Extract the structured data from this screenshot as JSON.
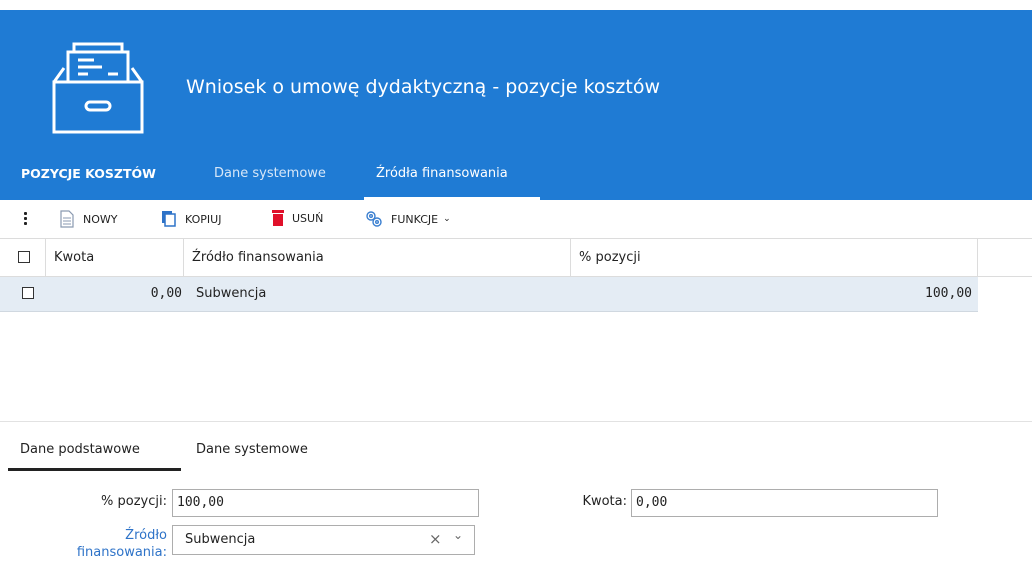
{
  "header": {
    "title": "Wniosek o umowę dydaktyczną - pozycje kosztów",
    "background_color": "#1f7bd4",
    "icon": "archive-drawer-icon"
  },
  "tabs": [
    {
      "label": "POZYCJE KOSZTÓW"
    },
    {
      "label": "Dane systemowe"
    },
    {
      "label": "Źródła finansowania",
      "active": true
    }
  ],
  "toolbar": {
    "menu_icon": "kebab-menu-icon",
    "new_label": "NOWY",
    "copy_label": "KOPIUJ",
    "delete_label": "USUŃ",
    "functions_label": "FUNKCJE"
  },
  "grid": {
    "columns": [
      "Kwota",
      "Źródło finansowania",
      "% pozycji"
    ],
    "rows": [
      {
        "kwota": "0,00",
        "zrodlo": "Subwencja",
        "procent": "100,00"
      }
    ]
  },
  "detail": {
    "tabs": [
      "Dane podstawowe",
      "Dane systemowe"
    ],
    "percent_label": "% pozycji:",
    "percent_value": "100,00",
    "kwota_label": "Kwota:",
    "kwota_value": "0,00",
    "source_label_line1": "Źródło",
    "source_label_line2": "finansowania:",
    "source_value": "Subwencja"
  }
}
